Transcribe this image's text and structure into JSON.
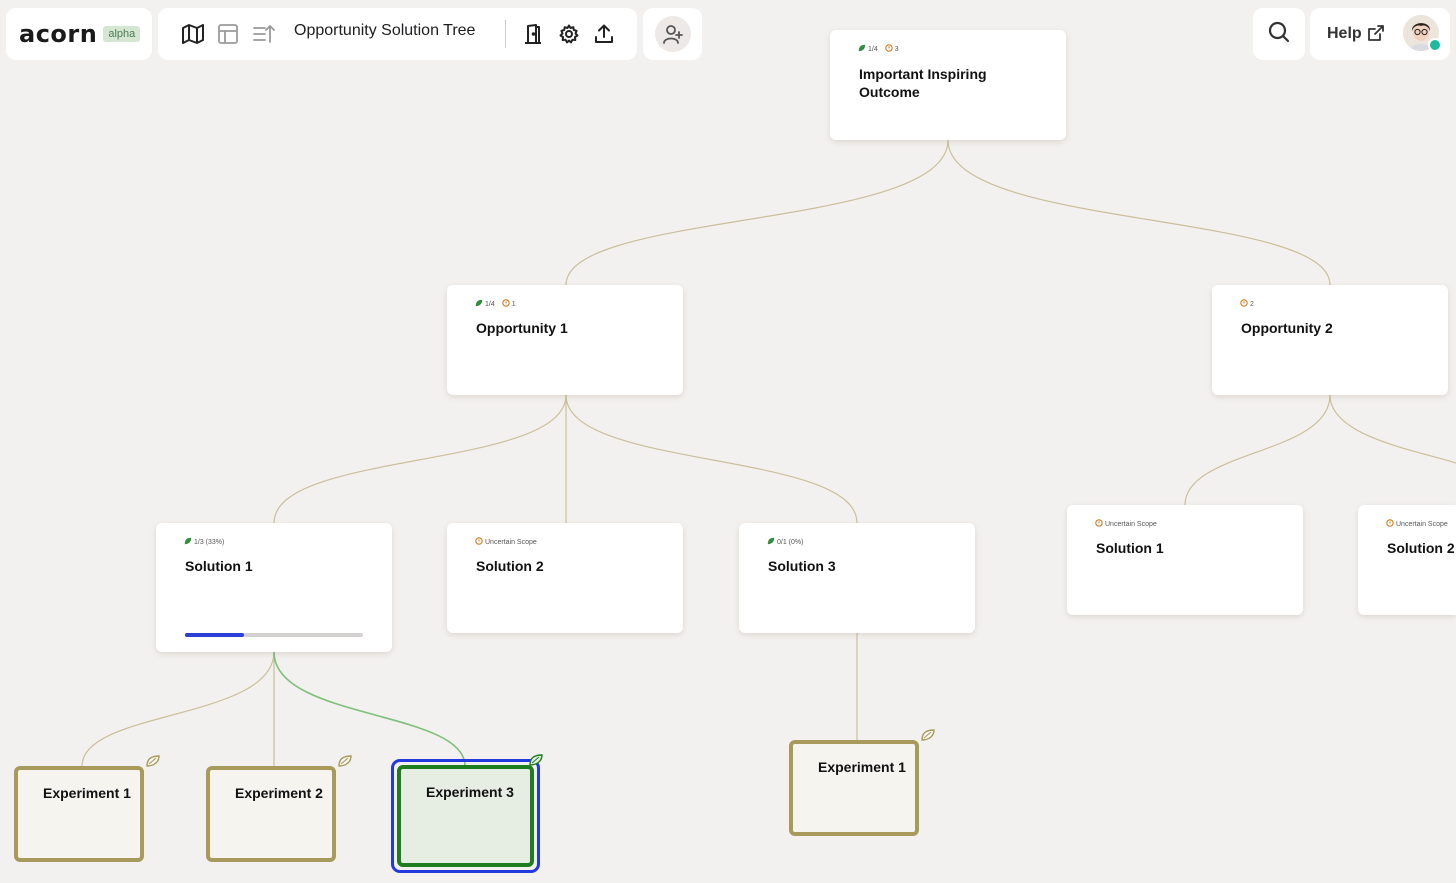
{
  "app": {
    "logo": "acorn",
    "badge": "alpha"
  },
  "toolbar": {
    "title": "Opportunity Solution Tree"
  },
  "help": {
    "label": "Help"
  },
  "colors": {
    "accent": "#2e3fd6",
    "complete": "#1e7d1e",
    "outcome_icon": "#d67a1c",
    "edge": "#cbbf9a"
  },
  "outcome": {
    "title": "Important Inspiring Outcome",
    "progress": "1/4",
    "count": "3"
  },
  "opportunity1": {
    "title": "Opportunity 1",
    "progress": "1/4",
    "count": "1"
  },
  "opportunity2": {
    "title": "Opportunity 2",
    "count": "2"
  },
  "o1_solution1": {
    "title": "Solution 1",
    "status": "1/3 (33%)",
    "progress_fraction": 0.33
  },
  "o1_solution2": {
    "title": "Solution 2",
    "status": "Uncertain Scope"
  },
  "o1_solution3": {
    "title": "Solution 3",
    "status": "0/1 (0%)"
  },
  "o2_solution1": {
    "title": "Solution 1",
    "status": "Uncertain Scope"
  },
  "o2_solution2": {
    "title": "Solution 2",
    "status": "Uncertain Scope"
  },
  "experiments": {
    "s1_e1": {
      "title": "Experiment 1"
    },
    "s1_e2": {
      "title": "Experiment 2"
    },
    "s1_e3": {
      "title": "Experiment 3",
      "complete": true,
      "selected": true
    },
    "s3_e1": {
      "title": "Experiment 1"
    }
  }
}
